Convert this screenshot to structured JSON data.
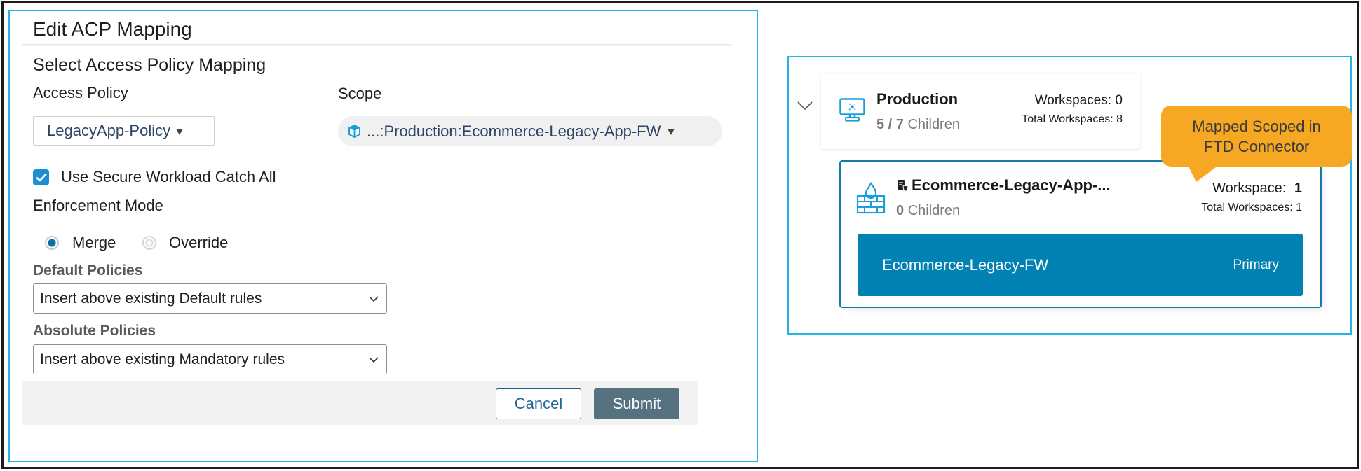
{
  "dialog": {
    "title": "Edit ACP Mapping",
    "section_title": "Select Access Policy Mapping",
    "access_policy": {
      "label": "Access Policy",
      "value": "LegacyApp-Policy"
    },
    "scope": {
      "label": "Scope",
      "value": "...:Production:Ecommerce-Legacy-App-FW",
      "icon": "cube-icon"
    },
    "catch_all": {
      "label": "Use Secure Workload Catch All",
      "checked": true
    },
    "enforcement": {
      "label": "Enforcement Mode",
      "options": [
        {
          "label": "Merge",
          "selected": true
        },
        {
          "label": "Override",
          "selected": false
        }
      ]
    },
    "default_policies": {
      "label": "Default Policies",
      "value": "Insert above existing Default rules"
    },
    "absolute_policies": {
      "label": "Absolute Policies",
      "value": "Insert above existing Mandatory rules"
    },
    "buttons": {
      "cancel": "Cancel",
      "submit": "Submit"
    }
  },
  "scope_tree": {
    "parent": {
      "name": "Production",
      "expanded": true,
      "children_count": "5 / 7",
      "children_label": "Children",
      "workspaces_text": "Workspaces: 0",
      "total_workspaces_text": "Total Workspaces: 8"
    },
    "child": {
      "name": "Ecommerce-Legacy-App-...",
      "children_count": "0",
      "children_label": "Children",
      "workspace_label": "Workspace:",
      "workspace_count": "1",
      "total_workspaces_text": "Total Workspaces: 1",
      "workspace_item": {
        "name": "Ecommerce-Legacy-FW",
        "role": "Primary"
      }
    },
    "callout": {
      "line1": "Mapped Scoped in",
      "line2": "FTD Connector"
    }
  },
  "colors": {
    "panel_border": "#22b5e3",
    "accent_blue": "#0281b3",
    "checkbox_blue": "#1b8fd0",
    "submit_bg": "#56717f",
    "callout_orange": "#f7a823"
  }
}
